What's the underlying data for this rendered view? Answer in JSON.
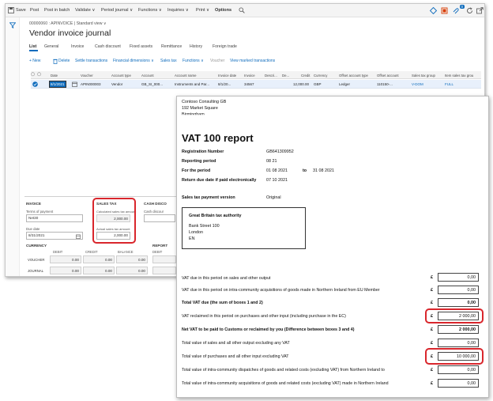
{
  "app": {
    "actionbar": {
      "save": "Save",
      "post": "Post",
      "post_in_batch": "Post in batch",
      "validate": "Validate ∨",
      "period_journal": "Period journal ∨",
      "functions": "Functions ∨",
      "inquiries": "Inquiries ∨",
      "print": "Print ∨",
      "options": "Options"
    },
    "badge": "0",
    "breadcrumb": "00000060 : APINVOICE  |  Standard view ∨",
    "title": "Vendor invoice journal",
    "tabs": [
      "List",
      "General",
      "Invoice",
      "Cash discount",
      "Fixed assets",
      "Remittance",
      "History",
      "Foreign trade"
    ],
    "toolbar": {
      "new": "+ New",
      "delete": "Delete",
      "settle": "Settle transactions",
      "fin_dims": "Financial dimensions ∨",
      "sales_tax": "Sales tax",
      "functions": "Functions ∨",
      "voucher": "Voucher",
      "view_marked": "View marked transactions"
    },
    "grid": {
      "headers": [
        "Date",
        "Voucher",
        "Account type",
        "Account",
        "Account name",
        "Invoice date",
        "Invoice",
        "Descri...",
        "De...",
        "Credit",
        "Currency",
        "Offset account type",
        "Offset account",
        "Sales tax group",
        "Item sales tax grou"
      ],
      "row": [
        "8/1/2021",
        "APIN000003",
        "Vendor",
        "GB_SI_000...",
        "Instruments and Par...",
        "8/1/20...",
        "34567",
        "",
        "",
        "12,000.00",
        "GBP",
        "Ledger",
        "110150-...",
        "V-DOM",
        "FULL"
      ]
    },
    "invoice": {
      "heading": "INVOICE",
      "terms_label": "Terms of payment",
      "terms_value": "Net30",
      "due_label": "Due date",
      "due_value": "8/31/2021"
    },
    "sales_tax": {
      "heading": "SALES TAX",
      "calc_label": "Calculated sales tax amount",
      "calc_value": "2,000.00",
      "actual_label": "Actual sales tax amount",
      "actual_value": "2,000.00"
    },
    "cash_discount": {
      "heading": "CASH DISCO",
      "label": "Cash discour"
    },
    "currency": {
      "heading": "CURRENCY",
      "cols": [
        "DEBIT",
        "CREDIT",
        "BALANCE"
      ],
      "rows": [
        {
          "label": "VOUCHER",
          "values": [
            "0.00",
            "0.00",
            "0.00"
          ]
        },
        {
          "label": "JOURNAL",
          "values": [
            "0.00",
            "0.00",
            "0.00"
          ]
        }
      ]
    },
    "report_sec": {
      "heading": "REPORT",
      "col": "DEBIT"
    }
  },
  "report": {
    "company": "Contoso Consulting GB",
    "address1": "192 Market Square",
    "address2": "Birmingham",
    "title": "VAT 100 report",
    "fields": [
      {
        "label": "Registration Number",
        "value": "GB641309952"
      },
      {
        "label": "Reporting period",
        "value": "08 21"
      },
      {
        "label": "For the period",
        "value": "01 08 2021"
      },
      {
        "label": "Return due date if paid electronically",
        "value": "07 10 2021"
      },
      {
        "label": "Sales tax payment version",
        "value": "Original"
      }
    ],
    "period_to": "to",
    "period_end": "31 08 2021",
    "authority": {
      "name": "Great Britain tax authority",
      "street": "Bank Street 100",
      "city": "London",
      "country": "EN"
    },
    "currency_symbol": "£",
    "lines": [
      {
        "label": "VAT due in this period on sales and other output",
        "value": "0,00",
        "bold": false
      },
      {
        "label": "VAT due in this period on intra-community acquisitions of goods made in Northern Ireland from EU Member",
        "value": "0,00",
        "bold": false
      },
      {
        "label": "Total VAT due (the sum of boxes 1 and 2)",
        "value": "0,00",
        "bold": true
      },
      {
        "label": "VAT reclaimed in this period on purchases and other input (including purchase in the EC)",
        "value": "2 000,00",
        "bold": false
      },
      {
        "label": "Net VAT to be paid to Customs or reclaimed by you (Difference between boxes 3 and 4)",
        "value": "2 000,00",
        "bold": true
      },
      {
        "label": "Total value of sales and all other output excluding any VAT",
        "value": "0,00",
        "bold": false
      },
      {
        "label": "Total value of purchases and all other input excluding VAT",
        "value": "10 000,00",
        "bold": false
      },
      {
        "label": "Total value of intra-community dispatches of goods and related costs (excluding VAT) from Northern Ireland to",
        "value": "0,00",
        "bold": false
      },
      {
        "label": "Total value of intra-community acquisitions of goods and related costs (excluding VAT) made in Northern Ireland",
        "value": "0,00",
        "bold": false
      }
    ]
  },
  "colors": {
    "accent": "#0f6cbd",
    "highlight": "#d9262c",
    "selected_row": "#e8f0fb"
  }
}
